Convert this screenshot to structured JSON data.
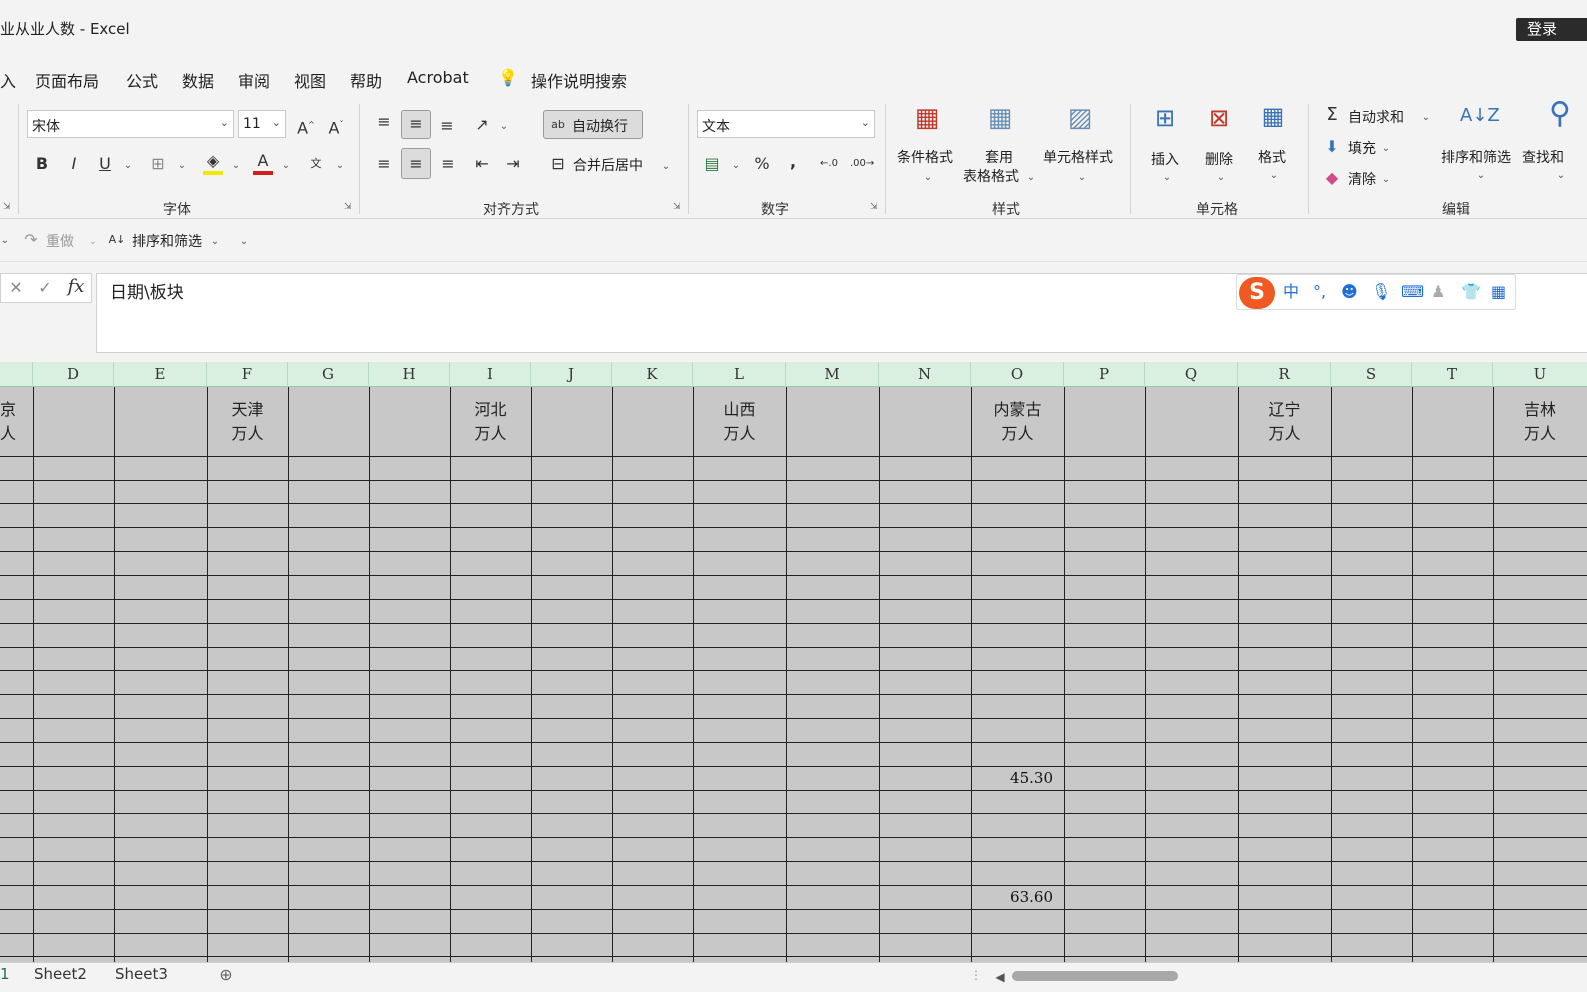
{
  "title": {
    "doc_name": "业从业人数 - Excel",
    "login": "登录"
  },
  "menu": {
    "items": [
      "入",
      "页面布局",
      "公式",
      "数据",
      "审阅",
      "视图",
      "帮助",
      "Acrobat"
    ],
    "search": "操作说明搜索"
  },
  "ribbon": {
    "font": {
      "name": "宋体",
      "size": "11",
      "group": "字体"
    },
    "alignment": {
      "wrap_text": "自动换行",
      "merge_center": "合并后居中",
      "group": "对齐方式"
    },
    "number": {
      "format": "文本",
      "group": "数字"
    },
    "styles": {
      "conditional": "条件格式",
      "table_l1": "套用",
      "table_l2": "表格格式",
      "cell_styles": "单元格样式",
      "group": "样式"
    },
    "cells": {
      "insert": "插入",
      "delete": "删除",
      "format": "格式",
      "group": "单元格"
    },
    "editing": {
      "autosum": "自动求和",
      "fill": "填充",
      "clear": "清除",
      "sort_filter": "排序和筛选",
      "find": "查找和",
      "group": "编辑"
    }
  },
  "qat": {
    "redo": "重做",
    "sort_filter": "排序和筛选"
  },
  "formula": {
    "content": "日期\\板块"
  },
  "columns": [
    "D",
    "E",
    "F",
    "G",
    "H",
    "I",
    "J",
    "K",
    "L",
    "M",
    "N",
    "O",
    "P",
    "Q",
    "R",
    "S",
    "T",
    "U"
  ],
  "header_cells": {
    "c": "京",
    "c2": "人",
    "f": "天津",
    "f2": "万人",
    "i": "河北",
    "i2": "万人",
    "l": "山西",
    "l2": "万人",
    "o": "内蒙古",
    "o2": "万人",
    "r": "辽宁",
    "r2": "万人",
    "u": "吉林",
    "u2": "万人"
  },
  "values": {
    "o_row13": "45.30",
    "o_row18": "63.60"
  },
  "sheets": {
    "first": "1",
    "s2": "Sheet2",
    "s3": "Sheet3"
  }
}
